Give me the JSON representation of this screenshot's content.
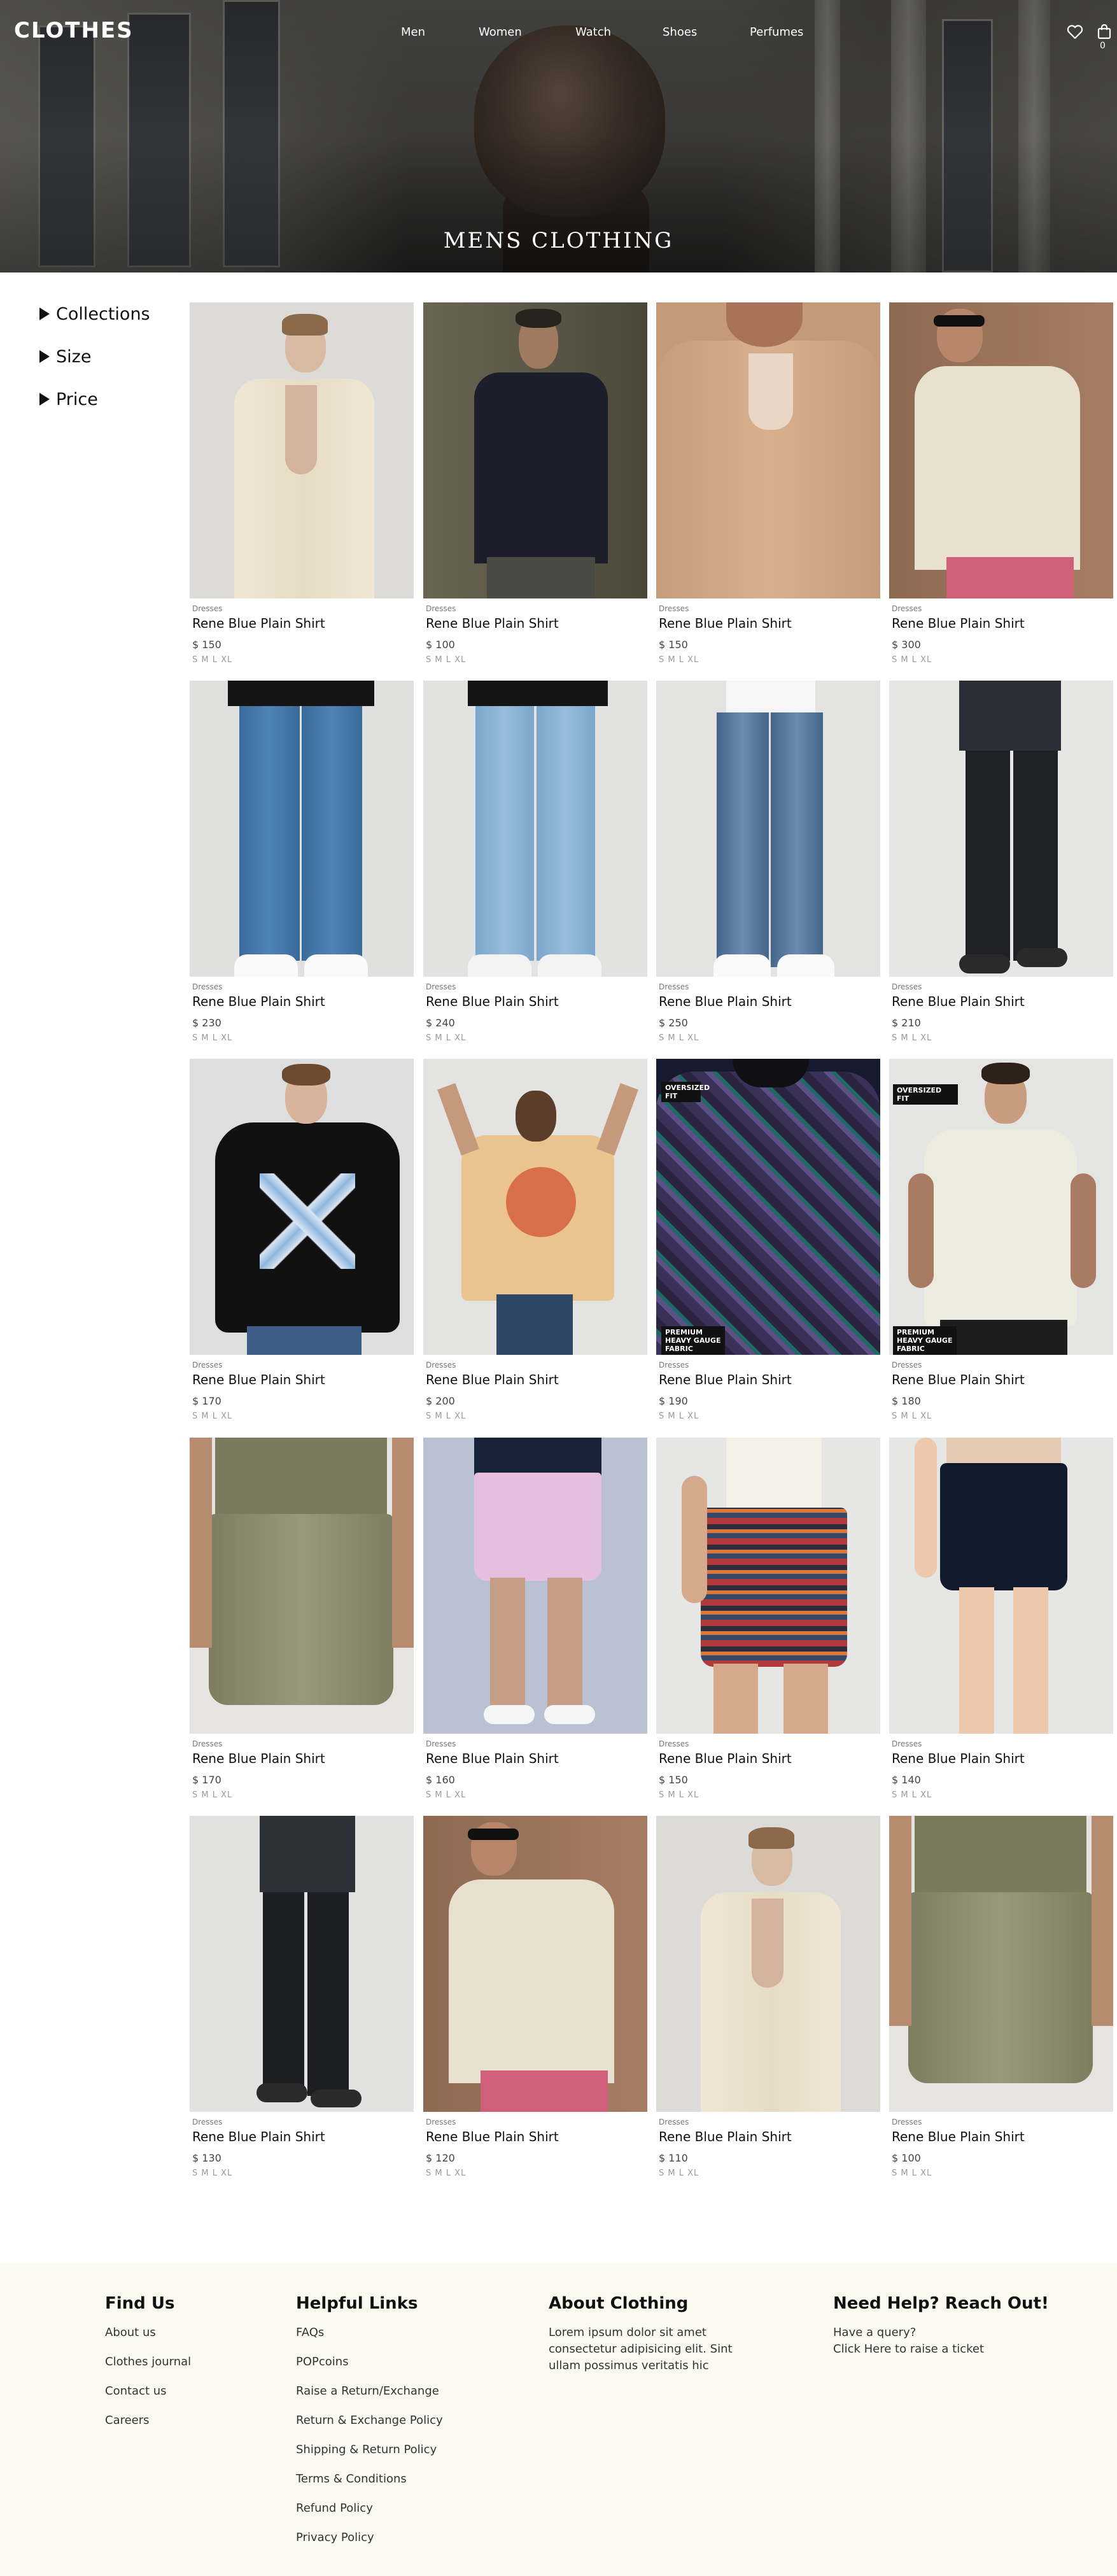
{
  "header": {
    "logo": "CLOTHES",
    "nav": [
      "Men",
      "Women",
      "Watch",
      "Shoes",
      "Perfumes"
    ],
    "cart_count": "0",
    "icons": [
      "heart-icon",
      "cart-icon"
    ]
  },
  "hero": {
    "title": "MENS CLOTHING"
  },
  "filters": [
    "Collections",
    "Size",
    "Price"
  ],
  "products": [
    {
      "category": "Dresses",
      "name": "Rene Blue Plain Shirt",
      "price": "$ 150",
      "sizes": "S M L XL"
    },
    {
      "category": "Dresses",
      "name": "Rene Blue Plain Shirt",
      "price": "$ 100",
      "sizes": "S M L XL"
    },
    {
      "category": "Dresses",
      "name": "Rene Blue Plain Shirt",
      "price": "$ 150",
      "sizes": "S M L XL"
    },
    {
      "category": "Dresses",
      "name": "Rene Blue Plain Shirt",
      "price": "$ 300",
      "sizes": "S M L XL"
    },
    {
      "category": "Dresses",
      "name": "Rene Blue Plain Shirt",
      "price": "$ 230",
      "sizes": "S M L XL"
    },
    {
      "category": "Dresses",
      "name": "Rene Blue Plain Shirt",
      "price": "$ 240",
      "sizes": "S M L XL"
    },
    {
      "category": "Dresses",
      "name": "Rene Blue Plain Shirt",
      "price": "$ 250",
      "sizes": "S M L XL"
    },
    {
      "category": "Dresses",
      "name": "Rene Blue Plain Shirt",
      "price": "$ 210",
      "sizes": "S M L XL"
    },
    {
      "category": "Dresses",
      "name": "Rene Blue Plain Shirt",
      "price": "$ 170",
      "sizes": "S M L XL"
    },
    {
      "category": "Dresses",
      "name": "Rene Blue Plain Shirt",
      "price": "$ 200",
      "sizes": "S M L XL"
    },
    {
      "category": "Dresses",
      "name": "Rene Blue Plain Shirt",
      "price": "$ 190",
      "sizes": "S M L XL"
    },
    {
      "category": "Dresses",
      "name": "Rene Blue Plain Shirt",
      "price": "$ 180",
      "sizes": "S M L XL"
    },
    {
      "category": "Dresses",
      "name": "Rene Blue Plain Shirt",
      "price": "$ 170",
      "sizes": "S M L XL"
    },
    {
      "category": "Dresses",
      "name": "Rene Blue Plain Shirt",
      "price": "$ 160",
      "sizes": "S M L XL"
    },
    {
      "category": "Dresses",
      "name": "Rene Blue Plain Shirt",
      "price": "$ 150",
      "sizes": "S M L XL"
    },
    {
      "category": "Dresses",
      "name": "Rene Blue Plain Shirt",
      "price": "$ 140",
      "sizes": "S M L XL"
    },
    {
      "category": "Dresses",
      "name": "Rene Blue Plain Shirt",
      "price": "$ 130",
      "sizes": "S M L XL"
    },
    {
      "category": "Dresses",
      "name": "Rene Blue Plain Shirt",
      "price": "$ 120",
      "sizes": "S M L XL"
    },
    {
      "category": "Dresses",
      "name": "Rene Blue Plain Shirt",
      "price": "$ 110",
      "sizes": "S M L XL"
    },
    {
      "category": "Dresses",
      "name": "Rene Blue Plain Shirt",
      "price": "$ 100",
      "sizes": "S M L XL"
    }
  ],
  "badges": {
    "oversized_fit_1": "OVERSIZED FIT",
    "premium_1": "PREMIUM HEAVY GAUGE FABRIC",
    "oversized_fit_2": "OVERSIZED FIT",
    "premium_2": "PREMIUM HEAVY GAUGE FABRIC"
  },
  "footer": {
    "find_us": {
      "title": "Find Us",
      "links": [
        "About us",
        "Clothes journal",
        "Contact us",
        "Careers"
      ]
    },
    "helpful": {
      "title": "Helpful Links",
      "links": [
        "FAQs",
        "POPcoins",
        "Raise a Return/Exchange",
        "Return & Exchange Policy",
        "Shipping & Return Policy",
        "Terms & Conditions",
        "Refund Policy",
        "Privacy Policy"
      ]
    },
    "about": {
      "title": "About Clothing",
      "text": "Lorem ipsum dolor sit amet consectetur adipisicing elit. Sint ullam possimus veritatis hic"
    },
    "help": {
      "title": "Need Help? Reach Out!",
      "line1": "Have a query?",
      "line2": "Click Here to raise a ticket"
    }
  },
  "colors": {
    "footer_bg": "#fafaf1",
    "text": "#111111",
    "muted": "#999999"
  }
}
